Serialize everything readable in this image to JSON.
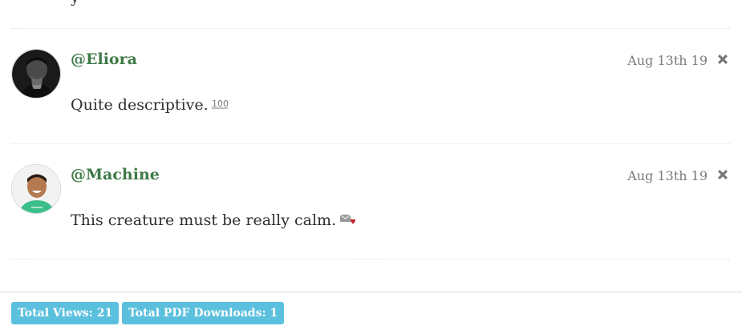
{
  "comments": [
    {
      "username": "@Eliora",
      "date": "Aug 13th 19",
      "text": "Quite descriptive.",
      "emoji_icon": "hundred-points-icon"
    },
    {
      "username": "@Machine",
      "date": "Aug 13th 19",
      "text": "This creature must be really calm.",
      "emoji_icon": "love-letter-icon"
    }
  ],
  "footer": {
    "views_label": "Total Views: 21",
    "downloads_label": "Total PDF Downloads: 1"
  },
  "colors": {
    "username": "#3e7a47",
    "badge": "#5bc0de",
    "delete_icon": "#777777"
  }
}
